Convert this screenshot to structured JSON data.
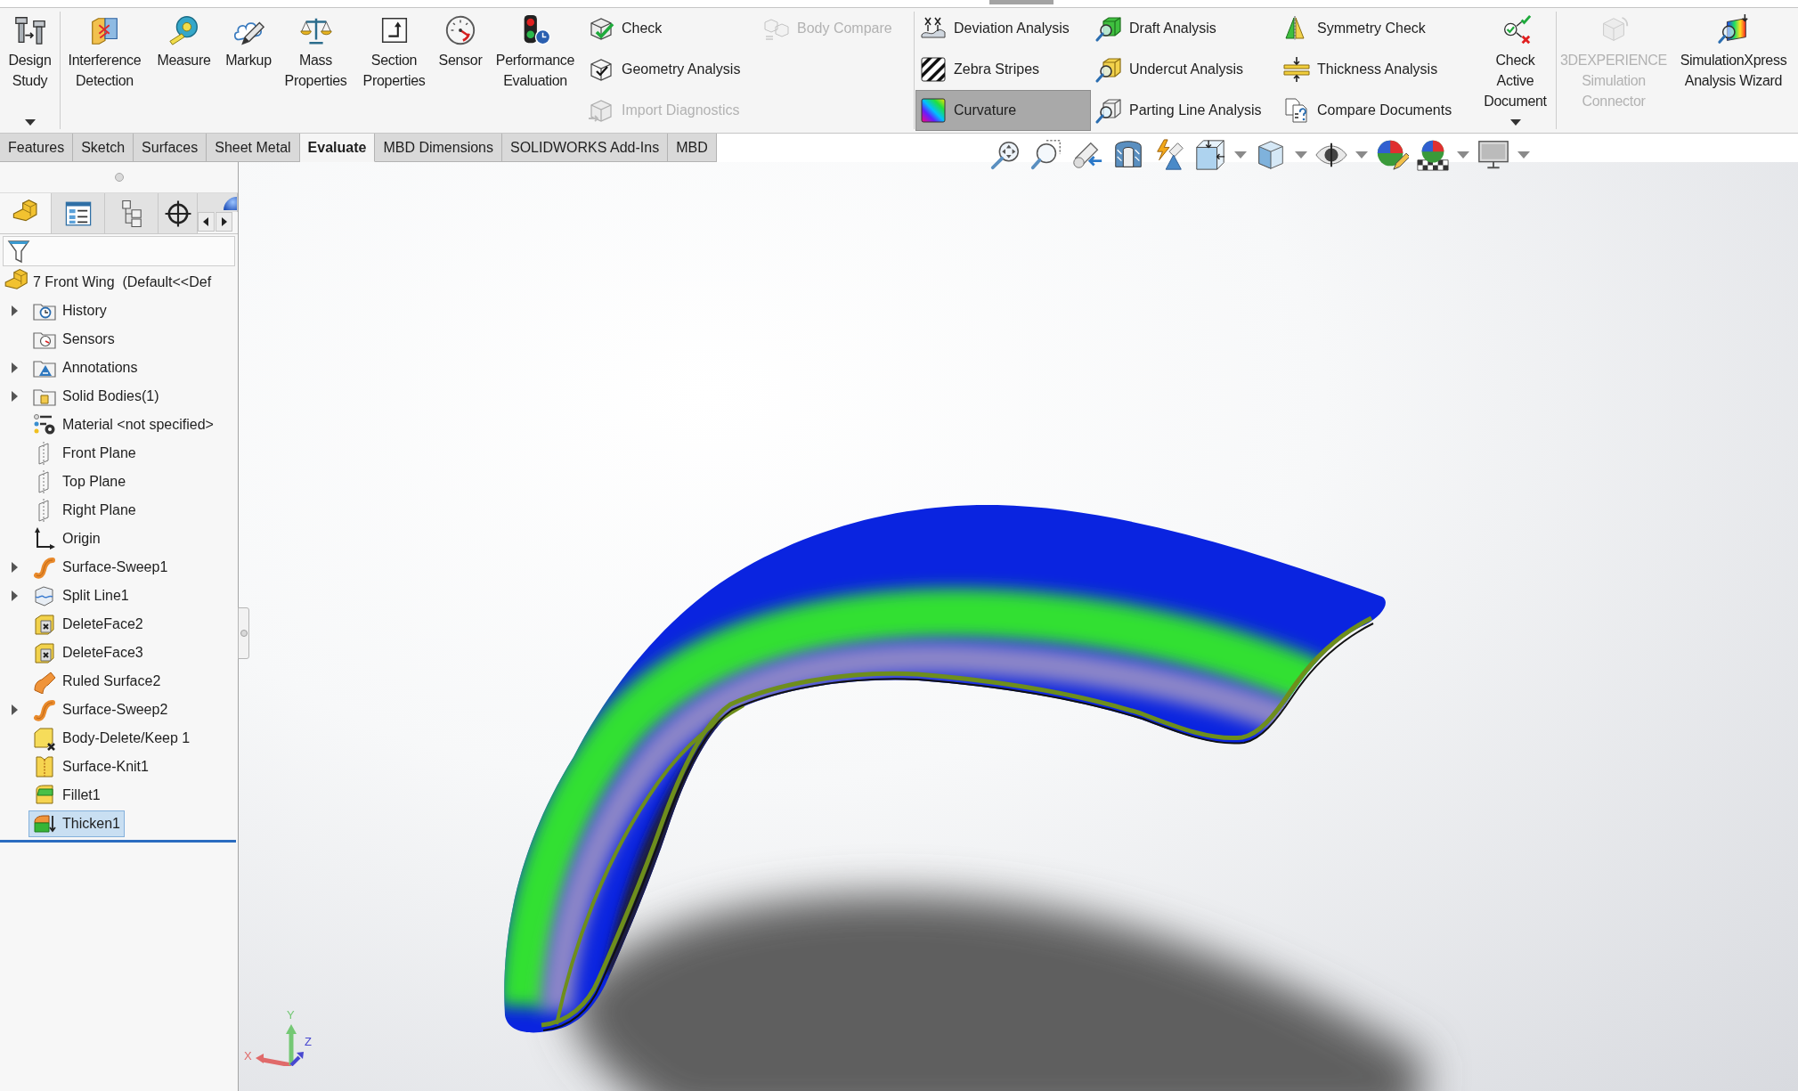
{
  "ribbon": {
    "sections": [
      {
        "items": [
          {
            "kind": "large",
            "label": "Design\nStudy",
            "dropdown": true,
            "disabled": false,
            "selected": false
          }
        ]
      },
      {
        "items": [
          {
            "kind": "large",
            "label": "Interference\nDetection",
            "dropdown": false,
            "disabled": false,
            "selected": false
          },
          {
            "kind": "large",
            "label": "Measure",
            "dropdown": false,
            "disabled": false,
            "selected": false
          },
          {
            "kind": "large",
            "label": "Markup",
            "dropdown": false,
            "disabled": false,
            "selected": false
          },
          {
            "kind": "large",
            "label": "Mass\nProperties",
            "dropdown": false,
            "disabled": false,
            "selected": false
          },
          {
            "kind": "large",
            "label": "Section\nProperties",
            "dropdown": false,
            "disabled": false,
            "selected": false
          },
          {
            "kind": "large",
            "label": "Sensor",
            "dropdown": false,
            "disabled": false,
            "selected": false
          },
          {
            "kind": "large",
            "label": "Performance\nEvaluation",
            "dropdown": false,
            "disabled": false,
            "selected": false
          },
          {
            "kind": "stack",
            "buttons": [
              {
                "label": "Check",
                "disabled": false,
                "selected": false
              },
              {
                "label": "Geometry Analysis",
                "disabled": false,
                "selected": false
              },
              {
                "label": "Import Diagnostics",
                "disabled": true,
                "selected": false
              }
            ]
          },
          {
            "kind": "stack",
            "buttons": [
              {
                "label": "Body Compare",
                "disabled": true,
                "selected": false
              }
            ]
          }
        ]
      },
      {
        "items": [
          {
            "kind": "stack",
            "buttons": [
              {
                "label": "Deviation Analysis",
                "disabled": false,
                "selected": false
              },
              {
                "label": "Zebra Stripes",
                "disabled": false,
                "selected": false
              },
              {
                "label": "Curvature",
                "disabled": false,
                "selected": true
              }
            ]
          },
          {
            "kind": "stack",
            "buttons": [
              {
                "label": "Draft Analysis",
                "disabled": false,
                "selected": false
              },
              {
                "label": "Undercut Analysis",
                "disabled": false,
                "selected": false
              },
              {
                "label": "Parting Line Analysis",
                "disabled": false,
                "selected": false
              }
            ]
          },
          {
            "kind": "stack",
            "buttons": [
              {
                "label": "Symmetry Check",
                "disabled": false,
                "selected": false
              },
              {
                "label": "Thickness Analysis",
                "disabled": false,
                "selected": false
              },
              {
                "label": "Compare Documents",
                "disabled": false,
                "selected": false
              }
            ]
          },
          {
            "kind": "large",
            "label": "Check\nActive\nDocument",
            "dropdown": true,
            "disabled": false,
            "selected": false
          }
        ]
      },
      {
        "items": [
          {
            "kind": "large",
            "label": "3DEXPERIENCE\nSimulation\nConnector",
            "dropdown": false,
            "disabled": true,
            "selected": false
          },
          {
            "kind": "large",
            "label": "SimulationXpress\nAnalysis Wizard",
            "dropdown": false,
            "disabled": false,
            "selected": false
          }
        ]
      }
    ]
  },
  "command_tabs": [
    {
      "label": "Features",
      "selected": false
    },
    {
      "label": "Sketch",
      "selected": false
    },
    {
      "label": "Surfaces",
      "selected": false
    },
    {
      "label": "Sheet Metal",
      "selected": false
    },
    {
      "label": "Evaluate",
      "selected": true
    },
    {
      "label": "MBD Dimensions",
      "selected": false
    },
    {
      "label": "SOLIDWORKS Add-Ins",
      "selected": false
    },
    {
      "label": "MBD",
      "selected": false
    }
  ],
  "feature_manager": {
    "tabs": [
      {
        "kind": "features",
        "selected": true
      },
      {
        "kind": "properties",
        "selected": false
      },
      {
        "kind": "configurations",
        "selected": false
      },
      {
        "kind": "dimxpert",
        "selected": false
      },
      {
        "kind": "display",
        "selected": false
      }
    ],
    "tree": {
      "label": "7 Front Wing  (Default<<Def",
      "items": [
        {
          "label": "History",
          "kind": "history",
          "expandable": true,
          "selected": false
        },
        {
          "label": "Sensors",
          "kind": "sensors",
          "expandable": false,
          "selected": false
        },
        {
          "label": "Annotations",
          "kind": "annotations",
          "expandable": true,
          "selected": false
        },
        {
          "label": "Solid Bodies(1)",
          "kind": "bodies",
          "expandable": true,
          "selected": false
        },
        {
          "label": "Material <not specified>",
          "kind": "material",
          "expandable": false,
          "selected": false
        },
        {
          "label": "Front Plane",
          "kind": "plane",
          "expandable": false,
          "selected": false
        },
        {
          "label": "Top Plane",
          "kind": "plane",
          "expandable": false,
          "selected": false
        },
        {
          "label": "Right Plane",
          "kind": "plane",
          "expandable": false,
          "selected": false
        },
        {
          "label": "Origin",
          "kind": "origin",
          "expandable": false,
          "selected": false
        },
        {
          "label": "Surface-Sweep1",
          "kind": "sweep",
          "expandable": true,
          "selected": false
        },
        {
          "label": "Split Line1",
          "kind": "splitline",
          "expandable": true,
          "selected": false
        },
        {
          "label": "DeleteFace2",
          "kind": "deleteface",
          "expandable": false,
          "selected": false
        },
        {
          "label": "DeleteFace3",
          "kind": "deleteface",
          "expandable": false,
          "selected": false
        },
        {
          "label": "Ruled Surface2",
          "kind": "ruled",
          "expandable": false,
          "selected": false
        },
        {
          "label": "Surface-Sweep2",
          "kind": "sweep",
          "expandable": true,
          "selected": false
        },
        {
          "label": "Body-Delete/Keep 1",
          "kind": "bodydelete",
          "expandable": false,
          "selected": false
        },
        {
          "label": "Surface-Knit1",
          "kind": "knit",
          "expandable": false,
          "selected": false
        },
        {
          "label": "Fillet1",
          "kind": "fillet",
          "expandable": false,
          "selected": false
        },
        {
          "label": "Thicken1",
          "kind": "thicken",
          "expandable": false,
          "selected": true
        }
      ]
    }
  },
  "triad": {
    "axes": [
      {
        "label": "X",
        "color": "#e06a6a"
      },
      {
        "label": "Y",
        "color": "#74c874"
      },
      {
        "label": "Z",
        "color": "#4848d0"
      }
    ]
  }
}
